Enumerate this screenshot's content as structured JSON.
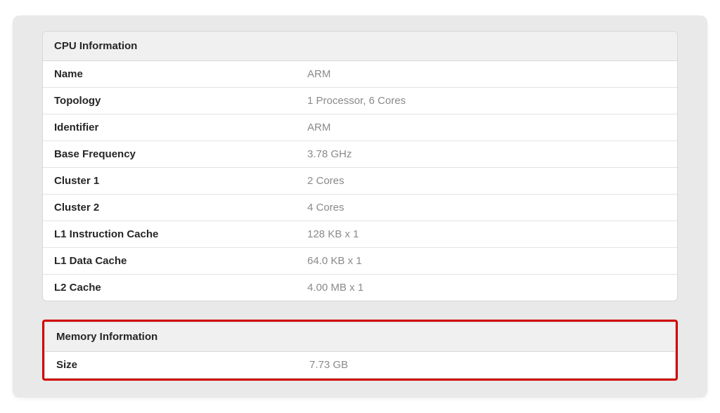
{
  "cpu": {
    "title": "CPU Information",
    "rows": [
      {
        "label": "Name",
        "value": "ARM"
      },
      {
        "label": "Topology",
        "value": "1 Processor, 6 Cores"
      },
      {
        "label": "Identifier",
        "value": "ARM"
      },
      {
        "label": "Base Frequency",
        "value": "3.78 GHz"
      },
      {
        "label": "Cluster 1",
        "value": "2 Cores"
      },
      {
        "label": "Cluster 2",
        "value": "4 Cores"
      },
      {
        "label": "L1 Instruction Cache",
        "value": "128 KB x 1"
      },
      {
        "label": "L1 Data Cache",
        "value": "64.0 KB x 1"
      },
      {
        "label": "L2 Cache",
        "value": "4.00 MB x 1"
      }
    ]
  },
  "memory": {
    "title": "Memory Information",
    "rows": [
      {
        "label": "Size",
        "value": "7.73 GB"
      }
    ]
  }
}
